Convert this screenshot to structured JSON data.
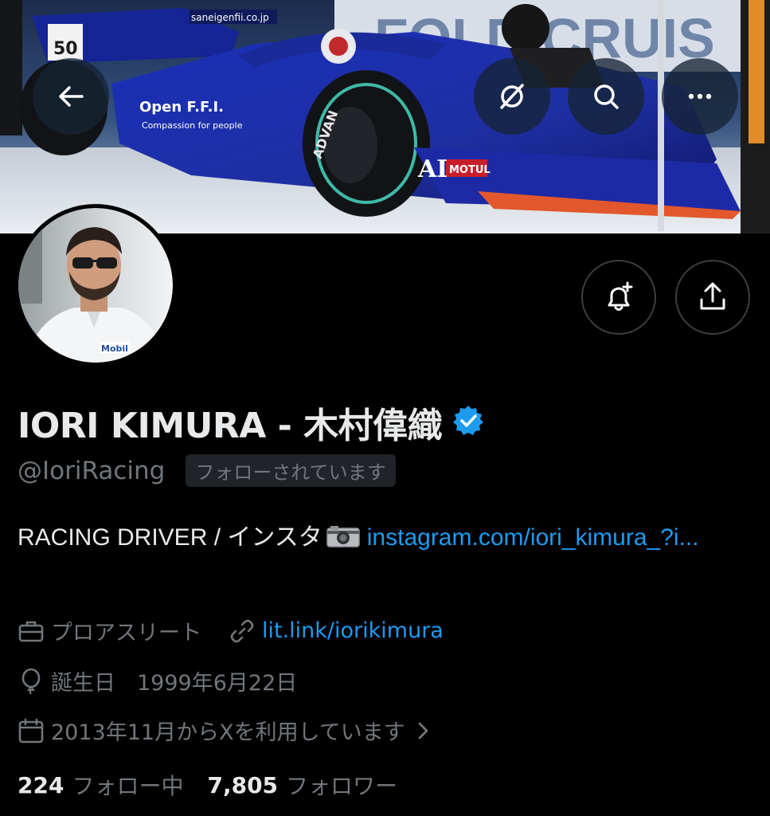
{
  "profile": {
    "display_name": "IORI KIMURA - 木村偉織",
    "handle": "@IoriRacing",
    "follows_you": "フォローされています",
    "bio_text": "RACING DRIVER / インスタ",
    "bio_link": "instagram.com/iori_kimura_?i...",
    "occupation": "プロアスリート",
    "website": "lit.link/iorikimura",
    "birthday": "誕生日　1999年6月22日",
    "joined": "2013年11月からXを利用しています",
    "following_count": "224",
    "following_label": "フォロー中",
    "followers_count": "7,805",
    "followers_label": "フォロワー"
  },
  "banner_text": {
    "car_number": "50",
    "sponsor_url": "saneigenfii.co.jp",
    "sponsor_text": "Open F.F.I.",
    "sponsor_sub": "Compassion for people",
    "tyre_brand": "ADVAN",
    "brand_motul": "MOTUL",
    "brand_ai": "AI",
    "wall_text": "FOLD CRUIS",
    "suit_brand": "Mobil"
  },
  "icons": {
    "back": "arrow-left-icon",
    "grok": "slash-circle-icon",
    "search": "search-icon",
    "more": "more-horizontal-icon",
    "notify": "bell-plus-icon",
    "share": "share-icon",
    "verified": "verified-badge-icon",
    "occupation": "briefcase-icon",
    "website": "link-icon",
    "birthday": "balloon-icon",
    "joined": "calendar-icon"
  },
  "colors": {
    "background": "#000000",
    "text_primary": "#e7e9ea",
    "text_secondary": "#71767b",
    "link": "#1d9bf0",
    "verified": "#1d9bf0"
  }
}
